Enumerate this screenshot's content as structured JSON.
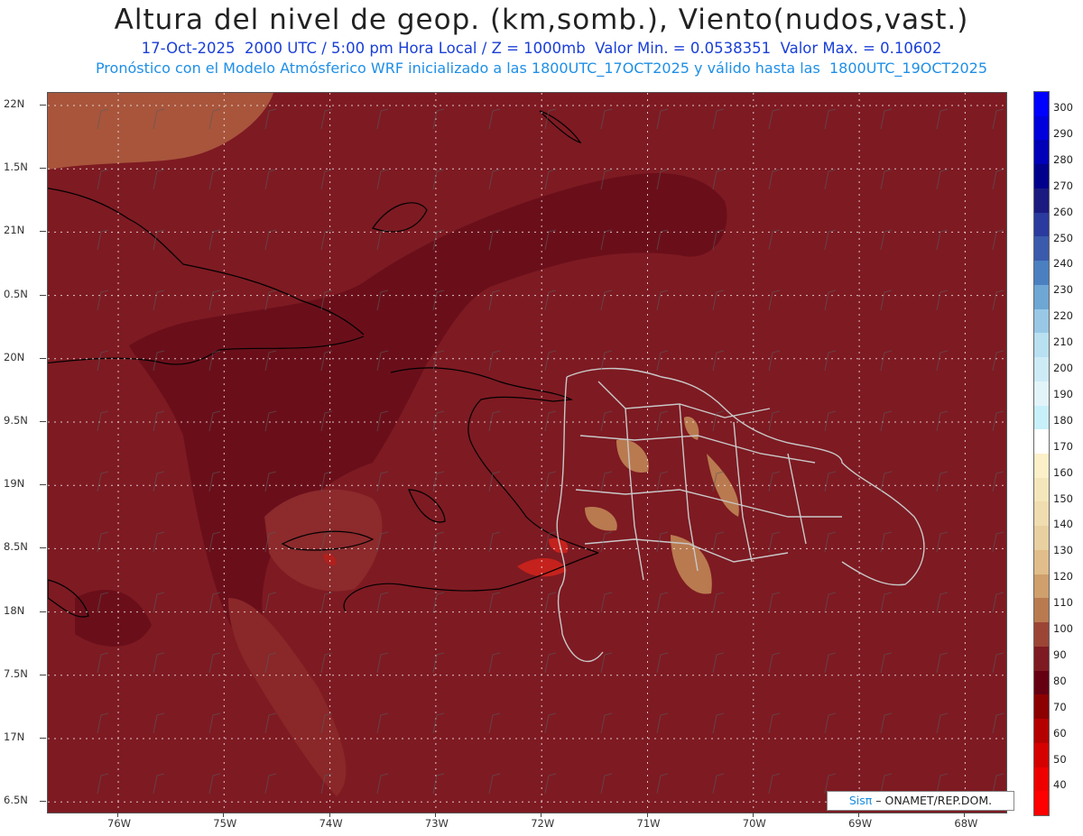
{
  "header": {
    "title": "Altura del nivel de geop. (km,somb.), Viento(nudos,vast.)",
    "line1": "17-Oct-2025  2000 UTC / 5:00 pm Hora Local / Z = 1000mb  Valor Min. = 0.0538351  Valor Max. = 0.10602",
    "line2": "Pronóstico con el Modelo Atmósferico WRF inicializado a las 1800UTC_17OCT2025 y válido hasta las  1800UTC_19OCT2025"
  },
  "axes": {
    "lat_labels": [
      "22N",
      "1.5N",
      "21N",
      "0.5N",
      "20N",
      "9.5N",
      "19N",
      "8.5N",
      "18N",
      "7.5N",
      "17N",
      "6.5N"
    ],
    "lon_labels": [
      "76W",
      "75W",
      "74W",
      "73W",
      "72W",
      "71W",
      "70W",
      "69W",
      "68W"
    ]
  },
  "colorbar": {
    "labels": [
      "300",
      "290",
      "280",
      "270",
      "260",
      "250",
      "240",
      "230",
      "220",
      "210",
      "200",
      "190",
      "180",
      "170",
      "160",
      "150",
      "140",
      "130",
      "120",
      "110",
      "100",
      "90",
      "80",
      "70",
      "60",
      "50",
      "40"
    ],
    "colors": [
      "#0000ff",
      "#0000dd",
      "#0000b8",
      "#00008c",
      "#1a1a80",
      "#2a3a9e",
      "#3a5aac",
      "#4a80c0",
      "#6ea6d4",
      "#98c8e6",
      "#b8e0f0",
      "#cdebf6",
      "#e2f4fa",
      "#c8f0fa",
      "#ffffff",
      "#fbf0c8",
      "#f4e6bb",
      "#efdcaf",
      "#e8d0a0",
      "#e0bd8a",
      "#cf9f6c",
      "#b97a50",
      "#9c4535",
      "#7e1a22",
      "#650012",
      "#8c0000",
      "#b50000",
      "#d50000",
      "#ee0000",
      "#ff0000"
    ]
  },
  "map": {
    "colors": {
      "background": "#7e1a22",
      "dark": "#6a0f1a",
      "light": "#9c4535",
      "tan": "#b97a50",
      "red": "#c5221d",
      "coast": "#000000",
      "provinces": "#c8c8c8",
      "grid": "#ffffff"
    }
  },
  "credit": {
    "sis": "Sisπ",
    "text": " –  ONAMET/REP.DOM."
  }
}
